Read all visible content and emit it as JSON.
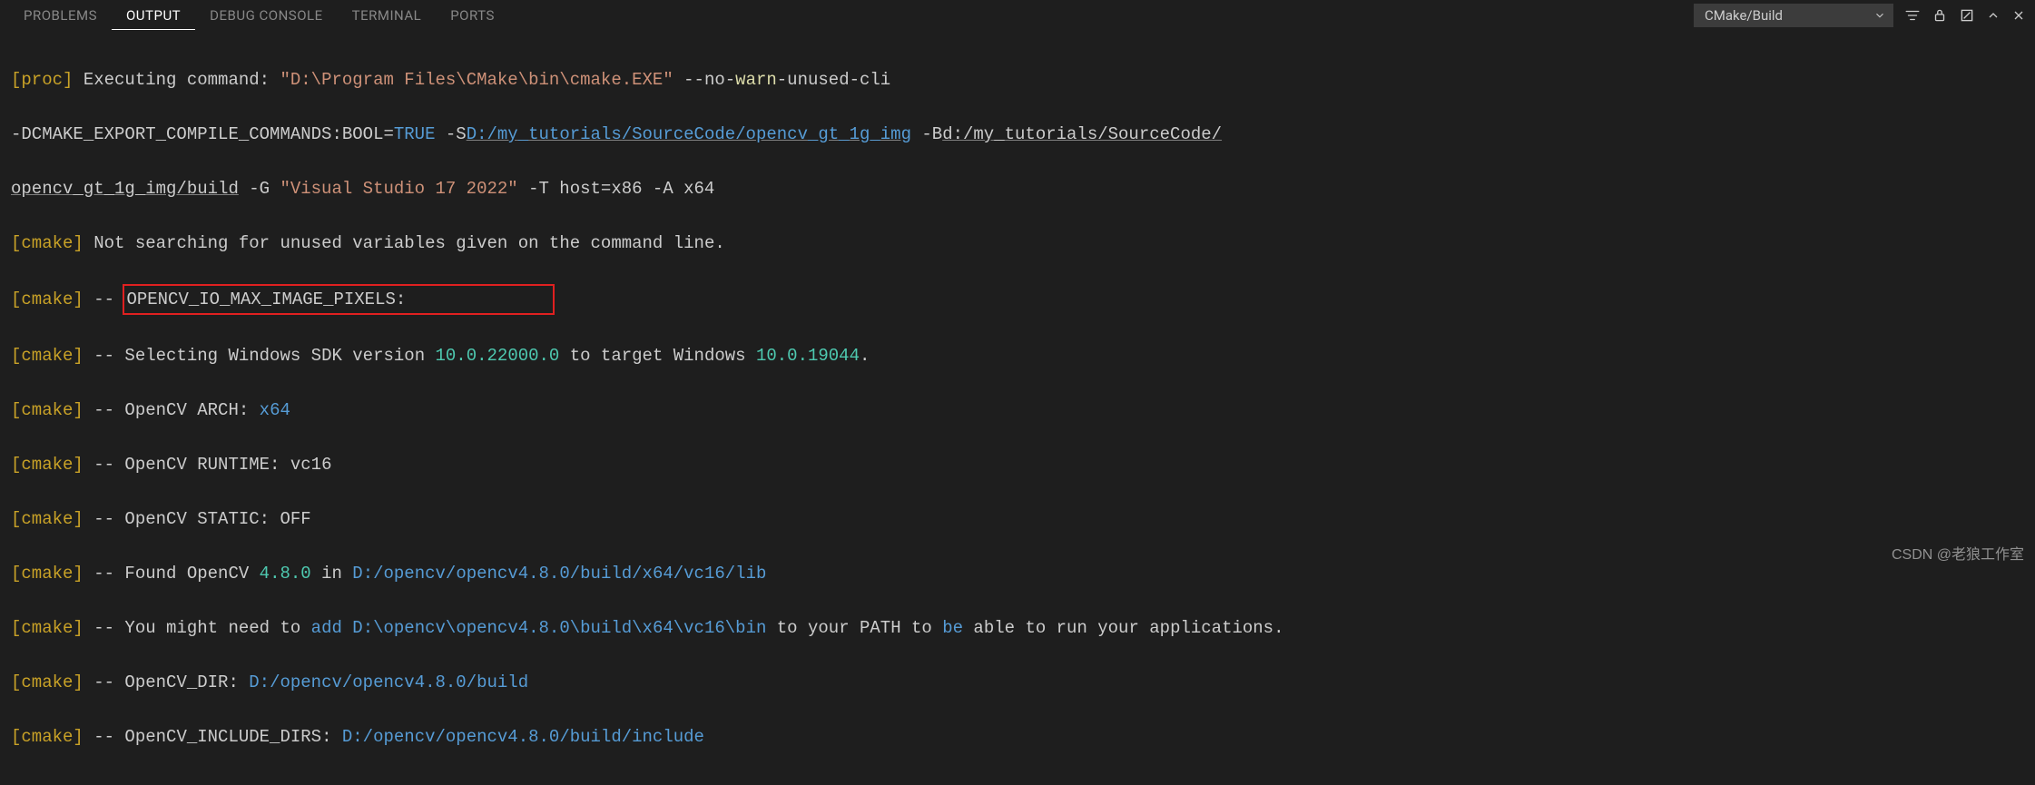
{
  "tabs": {
    "problems": "PROBLEMS",
    "output": "OUTPUT",
    "debug": "DEBUG CONSOLE",
    "terminal": "TERMINAL",
    "ports": "PORTS"
  },
  "dropdown": {
    "selected": "CMake/Build"
  },
  "lines": {
    "l1": {
      "tag": "proc",
      "a": " Executing command: ",
      "b": "\"D:\\Program Files\\CMake\\bin\\cmake.EXE\"",
      "c": " --no-",
      "d": "warn",
      "e": "-unused-cli"
    },
    "l2": {
      "a": "-DCMAKE_EXPORT_COMPILE_COMMANDS:BOOL=",
      "b": "TRUE",
      "c": " -S",
      "d": "D:/my_tutorials/SourceCode/opencv_gt_1g_img",
      "e": " -B",
      "f": "d:/my_tutorials/SourceCode/"
    },
    "l3": {
      "a": "opencv_gt_1g_img/build",
      "b": " -G ",
      "c": "\"Visual Studio 17 2022\"",
      "d": " -T host=x86 -A x64"
    },
    "l4": {
      "tag": "cmake",
      "a": " Not searching for unused variables given on the command line."
    },
    "l5": {
      "tag": "cmake",
      "a": " -- ",
      "b": "OPENCV_IO_MAX_IMAGE_PIXELS:              "
    },
    "l6": {
      "tag": "cmake",
      "a": " -- Selecting Windows SDK version ",
      "b": "10.0.22000.0",
      "c": " to target Windows ",
      "d": "10.0.19044",
      "e": "."
    },
    "l7": {
      "tag": "cmake",
      "a": " -- OpenCV ARCH: ",
      "b": "x64"
    },
    "l8": {
      "tag": "cmake",
      "a": " -- OpenCV RUNTIME: vc16"
    },
    "l9": {
      "tag": "cmake",
      "a": " -- OpenCV STATIC: OFF"
    },
    "l10": {
      "tag": "cmake",
      "a": " -- Found OpenCV ",
      "b": "4.8.0",
      "c": " in ",
      "d": "D:/opencv/opencv4.8.0/build/x64/vc16/lib"
    },
    "l11": {
      "tag": "cmake",
      "a": " -- You might need to ",
      "b": "add",
      "c": " ",
      "d": "D:\\opencv\\opencv4.8.0\\build\\x64\\vc16\\bin",
      "e": " to your PATH to ",
      "f": "be",
      "g": " able to run your applications."
    },
    "l12": {
      "tag": "cmake",
      "a": " -- OpenCV_DIR: ",
      "b": "D:/opencv/opencv4.8.0/build"
    },
    "l13": {
      "tag": "cmake",
      "a": " -- OpenCV_INCLUDE_DIRS: ",
      "b": "D:/opencv/opencv4.8.0/build/include"
    }
  },
  "watermark": "CSDN @老狼工作室"
}
